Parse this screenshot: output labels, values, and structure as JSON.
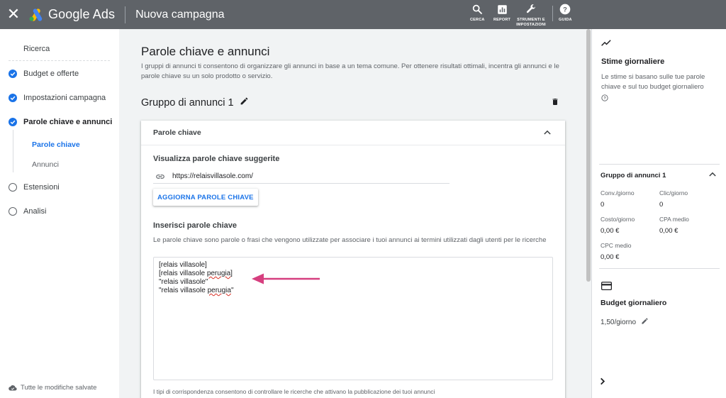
{
  "topbar": {
    "app_name": "Google Ads",
    "page_title": "Nuova campagna",
    "tools": {
      "search": "CERCA",
      "report": "REPORT",
      "tools": "STRUMENTI E IMPOSTAZIONI",
      "help": "GUIDA"
    }
  },
  "sidebar": {
    "steps": {
      "ricerca": "Ricerca",
      "budget": "Budget e offerte",
      "impostazioni": "Impostazioni campagna",
      "parole_annunci": "Parole chiave e annunci",
      "parole_chiave": "Parole chiave",
      "annunci": "Annunci",
      "estensioni": "Estensioni",
      "analisi": "Analisi"
    },
    "saved_status": "Tutte le modifiche salvate"
  },
  "main": {
    "title": "Parole chiave e annunci",
    "description": "I gruppi di annunci ti consentono di organizzare gli annunci in base a un tema comune. Per ottenere risultati ottimali, incentra gli annunci e le parole chiave su un solo prodotto o servizio.",
    "group_title": "Gruppo di annunci 1",
    "card": {
      "header": "Parole chiave",
      "suggest_title": "Visualizza parole chiave suggerite",
      "url": "https://relaisvillasole.com/",
      "update_button": "AGGIORNA PAROLE CHIAVE",
      "insert_title": "Inserisci parole chiave",
      "insert_desc": "Le parole chiave sono parole o frasi che vengono utilizzate per associare i tuoi annunci ai termini utilizzati dagli utenti per le ricerche",
      "keywords": {
        "k1": "[relais villasole]",
        "k2_pre": "[relais villasole ",
        "k2_sq": "perugia",
        "k2_post": "]",
        "k3": "\"relais villasole\"",
        "k4_pre": "\"relais villasole ",
        "k4_sq": "perugia",
        "k4_post": "\""
      },
      "match_note": "I tipi di corrispondenza consentono di controllare le ricerche che attivano la pubblicazione dei tuoi annunci"
    }
  },
  "rpanel": {
    "title": "Stime giornaliere",
    "description": "Le stime si basano sulle tue parole chiave e sul tuo budget giornaliero",
    "group": "Gruppo di annunci 1",
    "stats": {
      "conv_label": "Conv./giorno",
      "conv_value": "0",
      "clic_label": "Clic/giorno",
      "clic_value": "0",
      "costo_label": "Costo/giorno",
      "costo_value": "0,00 €",
      "cpa_label": "CPA medio",
      "cpa_value": "0,00 €",
      "cpc_label": "CPC medio",
      "cpc_value": "0,00 €"
    },
    "budget_title": "Budget giornaliero",
    "budget_value": "1,50/giorno"
  },
  "colors": {
    "topbar": "#5f6368",
    "accent": "#1a73e8",
    "arrow": "#d63f7f"
  }
}
